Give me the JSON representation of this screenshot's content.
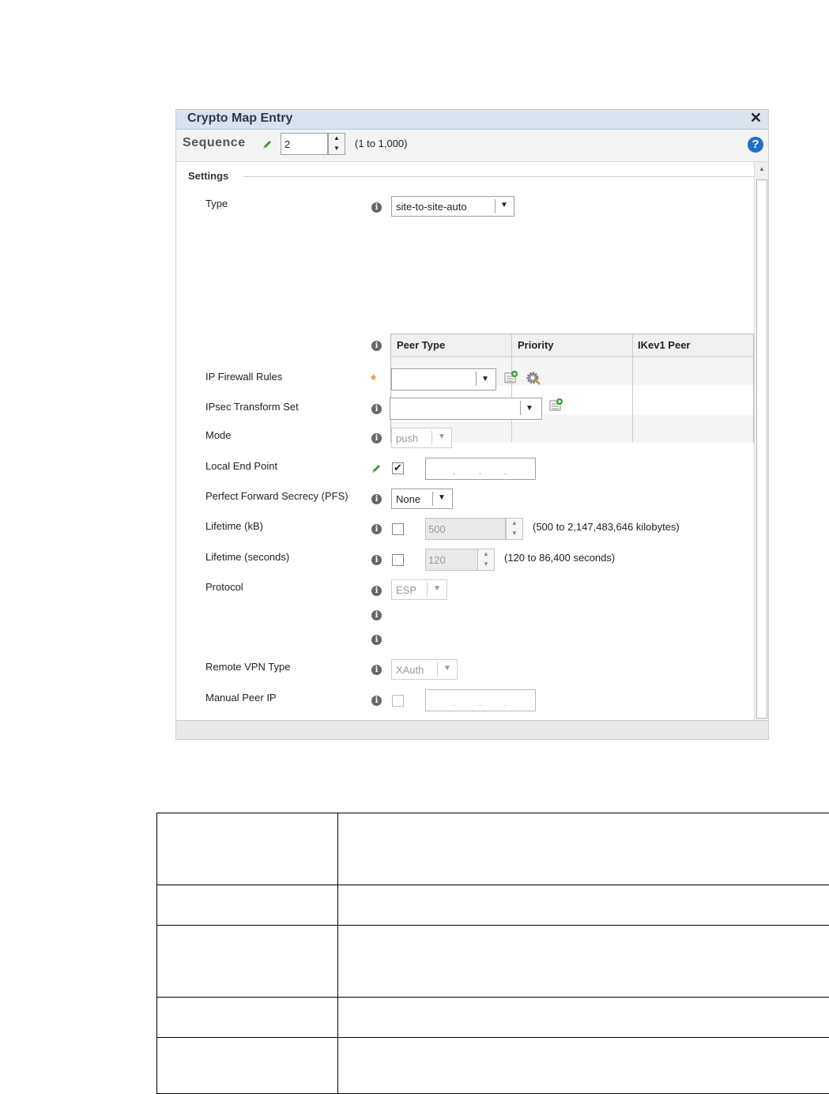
{
  "dialog": {
    "title": "Crypto Map Entry",
    "close_symbol": "✕",
    "help_symbol": "?",
    "sequence_label": "Sequence",
    "sequence_value": "2",
    "sequence_range": "(1 to 1,000)"
  },
  "settings": {
    "heading": "Settings",
    "type": {
      "label": "Type",
      "value": "site-to-site-auto"
    },
    "peer_table": {
      "columns": [
        "Peer Type",
        "Priority",
        "IKev1 Peer"
      ],
      "rows": []
    },
    "ip_firewall_rules": {
      "label": "IP Firewall Rules",
      "value": ""
    },
    "ipsec_transform_set": {
      "label": "IPsec Transform Set",
      "value": ""
    },
    "mode": {
      "label": "Mode",
      "value": "push"
    },
    "local_end_point": {
      "label": "Local End Point",
      "checked": true,
      "ip_dots": [
        ".",
        ".",
        "."
      ]
    },
    "pfs": {
      "label": "Perfect Forward Secrecy (PFS)",
      "value": "None"
    },
    "lifetime_kb": {
      "label": "Lifetime (kB)",
      "checked": false,
      "value": "500",
      "range": "(500 to 2,147,483,646 kilobytes)"
    },
    "lifetime_seconds": {
      "label": "Lifetime (seconds)",
      "checked": false,
      "value": "120",
      "range": "(120 to 86,400 seconds)"
    },
    "protocol": {
      "label": "Protocol",
      "value": "ESP"
    },
    "remote_vpn_type": {
      "label": "Remote VPN Type",
      "value": "XAuth"
    },
    "manual_peer_ip": {
      "label": "Manual Peer IP",
      "checked": false,
      "ip_dots": [
        ".",
        ".",
        "."
      ]
    }
  },
  "colors": {
    "title_bar": "#d9e3ee",
    "help": "#1f6fd1",
    "required_star": "#f0902a",
    "pencil": "#3a9a2a"
  },
  "icons": {
    "info": "i",
    "star": "*",
    "dropdown": "▼",
    "up": "▲",
    "down": "▼",
    "check": "✔"
  }
}
